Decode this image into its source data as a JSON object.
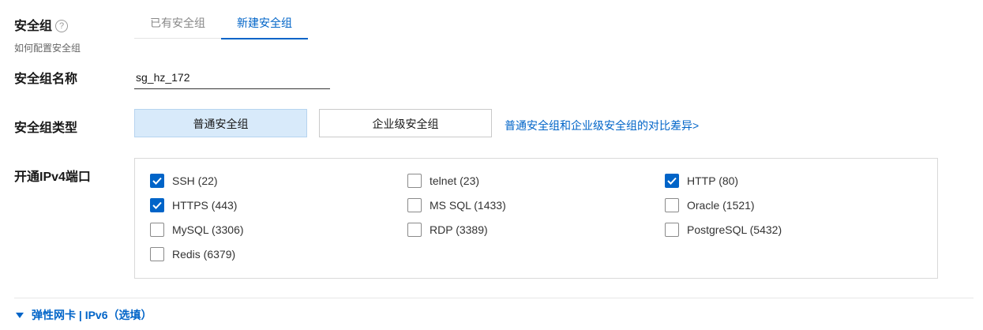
{
  "security_group": {
    "title": "安全组",
    "help_icon": "question-circle-icon",
    "hint": "如何配置安全组",
    "tabs": [
      {
        "label": "已有安全组",
        "active": false
      },
      {
        "label": "新建安全组",
        "active": true
      }
    ]
  },
  "name_field": {
    "label": "安全组名称",
    "value": "sg_hz_172"
  },
  "type_field": {
    "label": "安全组类型",
    "options": [
      {
        "label": "普通安全组",
        "selected": true
      },
      {
        "label": "企业级安全组",
        "selected": false
      }
    ],
    "compare_link": "普通安全组和企业级安全组的对比差异>"
  },
  "ports": {
    "label": "开通IPv4端口",
    "items": [
      {
        "label": "SSH (22)",
        "checked": true
      },
      {
        "label": "telnet (23)",
        "checked": false
      },
      {
        "label": "HTTP (80)",
        "checked": true
      },
      {
        "label": "HTTPS (443)",
        "checked": true
      },
      {
        "label": "MS SQL (1433)",
        "checked": false
      },
      {
        "label": "Oracle (1521)",
        "checked": false
      },
      {
        "label": "MySQL (3306)",
        "checked": false
      },
      {
        "label": "RDP (3389)",
        "checked": false
      },
      {
        "label": "PostgreSQL (5432)",
        "checked": false
      },
      {
        "label": "Redis (6379)",
        "checked": false
      }
    ]
  },
  "expander": {
    "icon": "caret-down-icon",
    "label": "弹性网卡 | IPv6（选填）"
  },
  "colors": {
    "accent": "#0064c8",
    "selected_bg": "#d8eafa",
    "border": "#d9d9d9"
  }
}
